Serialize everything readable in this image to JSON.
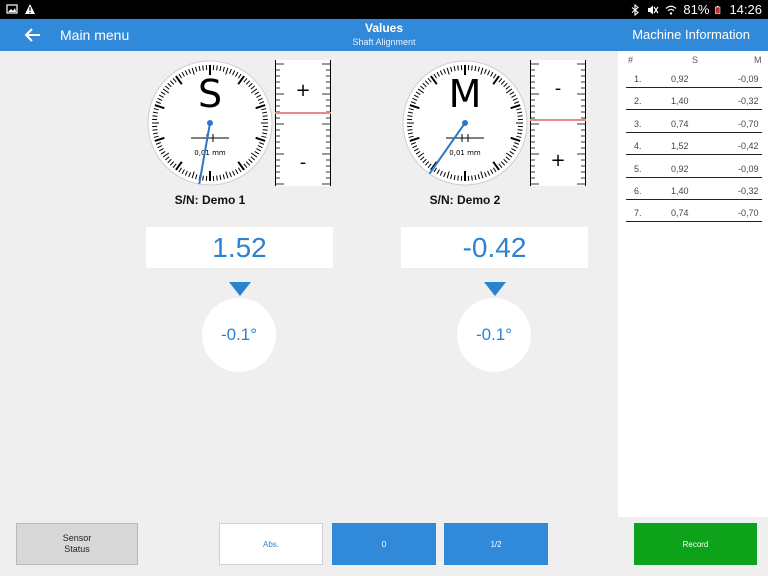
{
  "status_bar": {
    "battery": "81%",
    "time": "14:26"
  },
  "app_bar": {
    "back_label": "Main menu",
    "title": "Values",
    "subtitle": "Shaft Alignment",
    "right_label": "Machine Information"
  },
  "gauges": [
    {
      "letter": "S",
      "unit": "0,01 mm",
      "serial": "S/N: Demo 1",
      "value": "1.52",
      "angle": "-0.1°",
      "scale_top": "+",
      "scale_bottom": "-"
    },
    {
      "letter": "M",
      "unit": "0,01 mm",
      "serial": "S/N: Demo 2",
      "value": "-0.42",
      "angle": "-0.1°",
      "scale_top": "-",
      "scale_bottom": "+"
    }
  ],
  "table": {
    "headers": [
      "#",
      "S",
      "M"
    ],
    "rows": [
      [
        "1.",
        "0,92",
        "-0,09"
      ],
      [
        "2.",
        "1,40",
        "-0,32"
      ],
      [
        "3.",
        "0,74",
        "-0,70"
      ],
      [
        "4.",
        "1,52",
        "-0,42"
      ],
      [
        "5.",
        "0,92",
        "-0,09"
      ],
      [
        "6.",
        "1,40",
        "-0,32"
      ],
      [
        "7.",
        "0,74",
        "-0,70"
      ]
    ]
  },
  "buttons": {
    "sensor_status_line1": "Sensor",
    "sensor_status_line2": "Status",
    "abs": "Abs.",
    "zero": "0",
    "half": "1/2",
    "record": "Record"
  },
  "colors": {
    "app_bar": "#3189d9",
    "accent_blue": "#2c82d0",
    "record_green": "#0ea11a",
    "needle": "#2a78c6",
    "scale_marker": "#e58a8a"
  }
}
